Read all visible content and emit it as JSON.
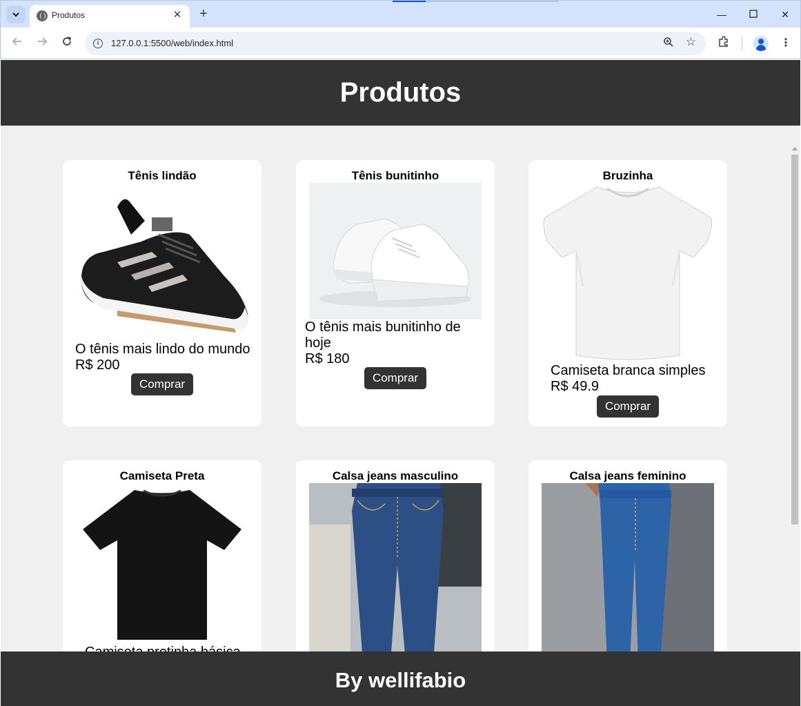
{
  "browser": {
    "tab_title": "Produtos",
    "url": "127.0.0.1:5500/web/index.html"
  },
  "page": {
    "header_title": "Produtos",
    "footer_text": "By wellifabio"
  },
  "products": [
    {
      "name": "Tênis lindão",
      "description": "O tênis mais lindo do mundo",
      "price": "R$ 200",
      "button": "Comprar",
      "image": "black-sneaker"
    },
    {
      "name": "Tênis bunitinho",
      "description": "O tênis mais bunitinho de hoje",
      "price": "R$ 180",
      "button": "Comprar",
      "image": "white-sneakers"
    },
    {
      "name": "Bruzinha",
      "description": "Camiseta branca simples",
      "price": "R$ 49.9",
      "button": "Comprar",
      "image": "white-tshirt"
    },
    {
      "name": "Camiseta Preta",
      "description": "Camiseta pretinha básica",
      "image": "black-tshirt"
    },
    {
      "name": "Calsa jeans masculino",
      "image": "mens-jeans"
    },
    {
      "name": "Calsa jeans feminino",
      "image": "womens-jeans"
    }
  ]
}
